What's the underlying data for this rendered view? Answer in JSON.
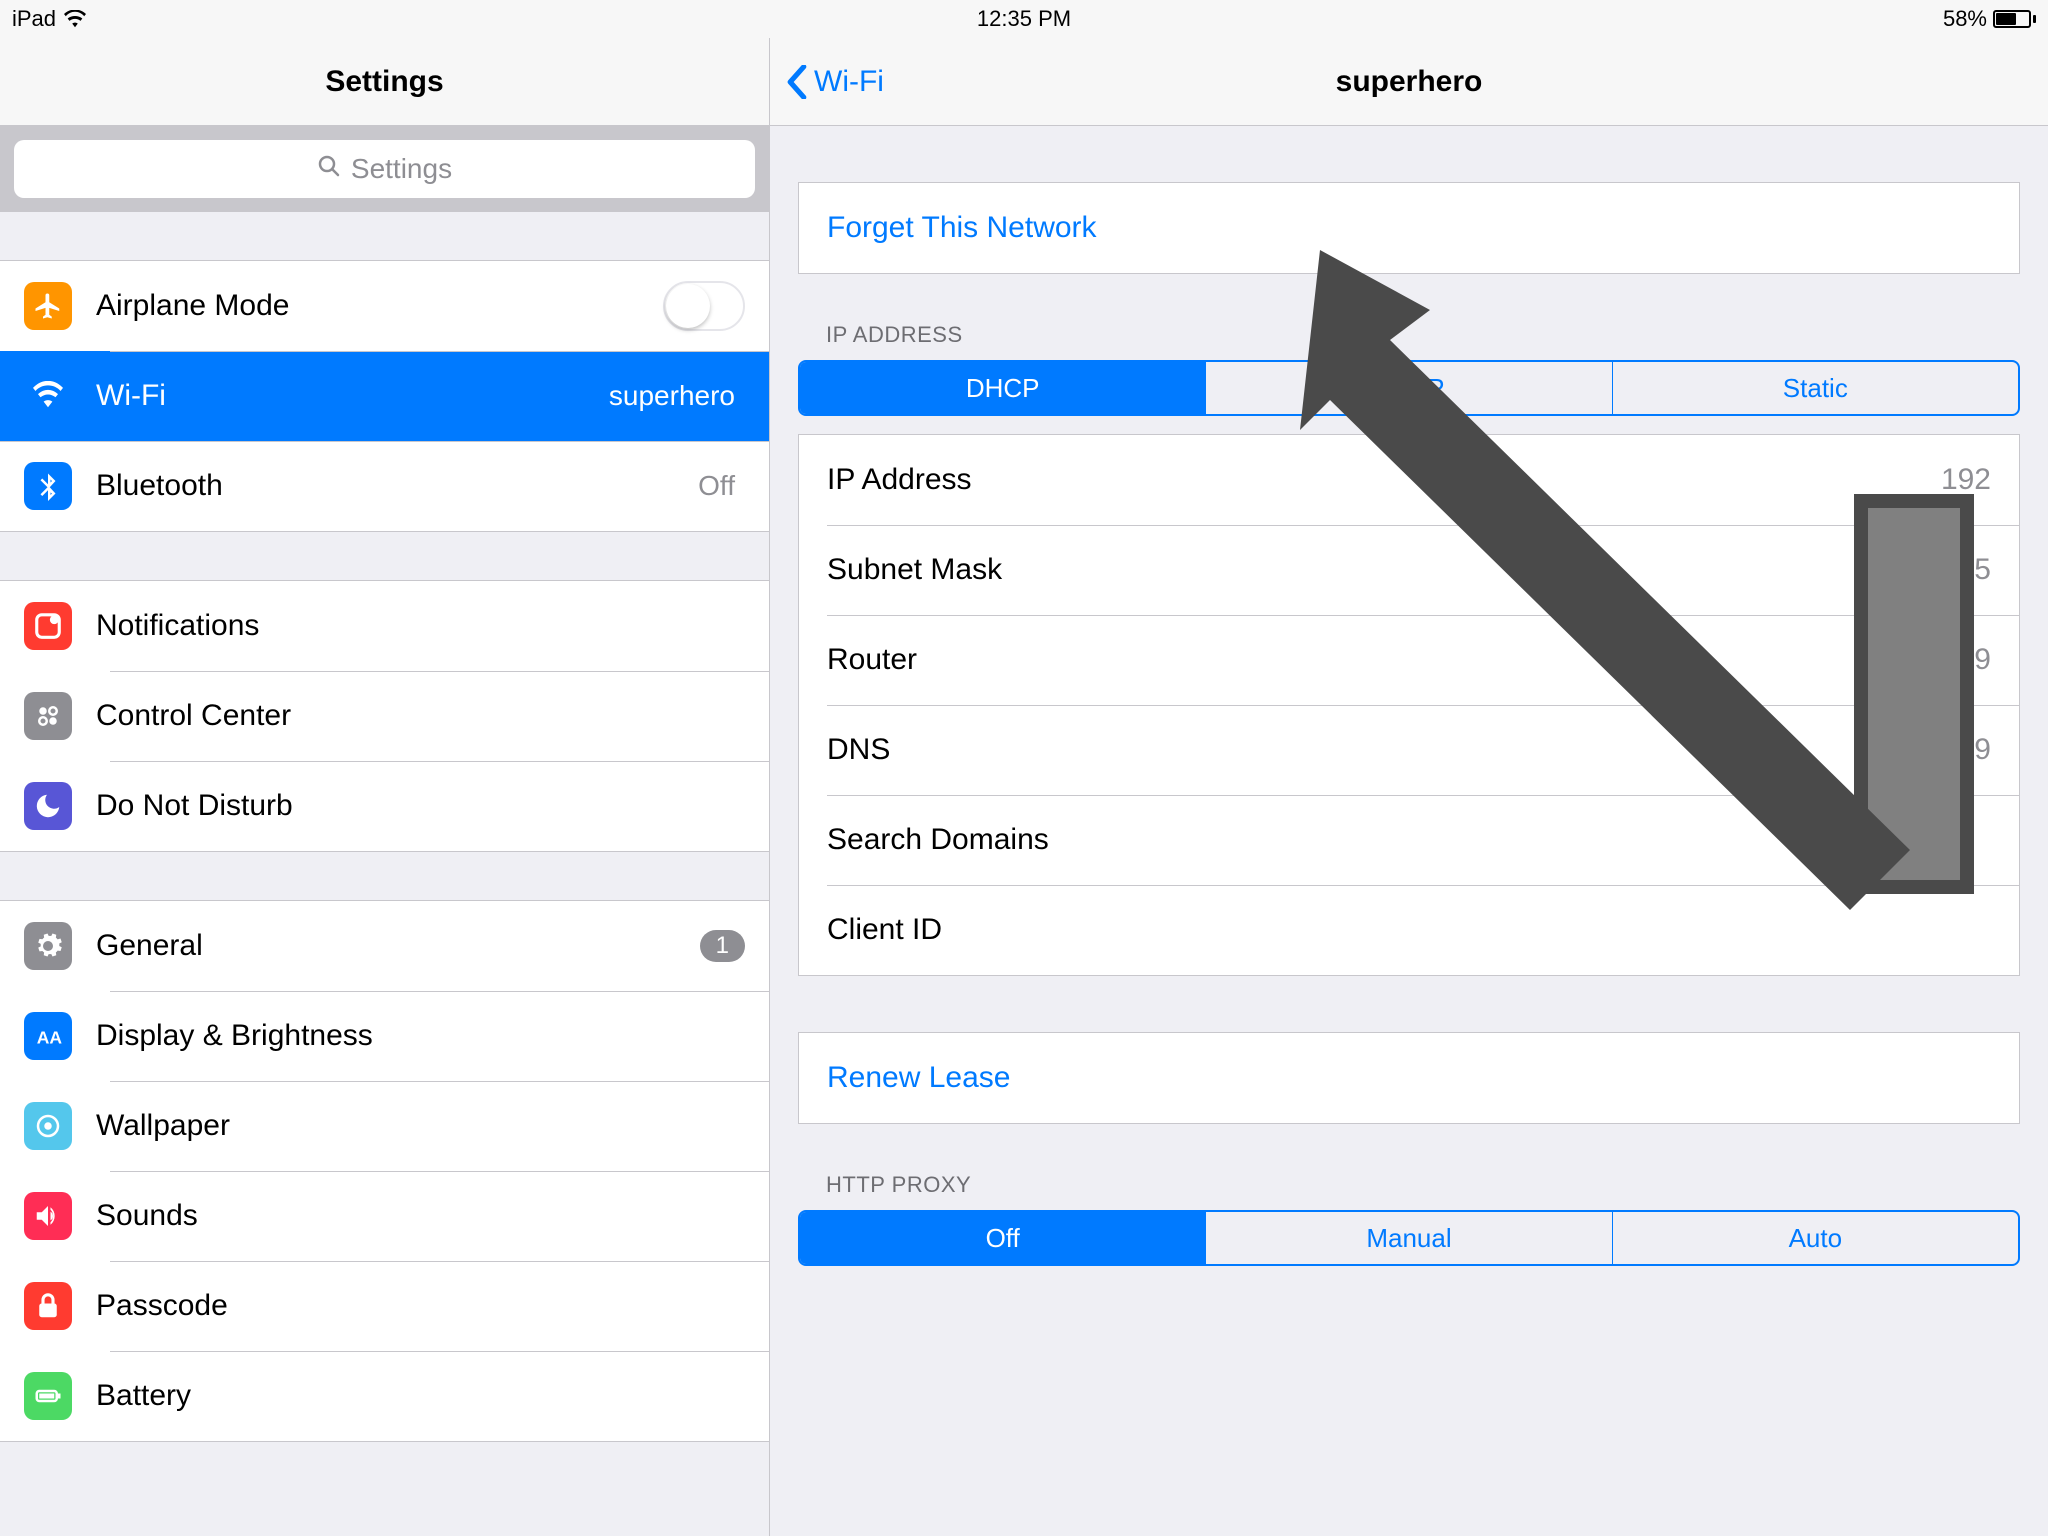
{
  "status": {
    "device": "iPad",
    "time": "12:35 PM",
    "battery_pct": "58%"
  },
  "left": {
    "title": "Settings",
    "search_placeholder": "Settings",
    "airplane": "Airplane Mode",
    "wifi": "Wi-Fi",
    "wifi_value": "superhero",
    "bluetooth": "Bluetooth",
    "bluetooth_value": "Off",
    "notifications": "Notifications",
    "control_center": "Control Center",
    "dnd": "Do Not Disturb",
    "general": "General",
    "general_badge": "1",
    "display": "Display & Brightness",
    "wallpaper": "Wallpaper",
    "sounds": "Sounds",
    "passcode": "Passcode",
    "battery": "Battery"
  },
  "right": {
    "back": "Wi-Fi",
    "title": "superhero",
    "forget": "Forget This Network",
    "ip_header": "IP ADDRESS",
    "seg_dhcp": "DHCP",
    "seg_bootp": "BootP",
    "seg_static": "Static",
    "rows": {
      "ip_label": "IP Address",
      "ip_value": "192",
      "subnet_label": "Subnet Mask",
      "subnet_value": "255.25",
      "router_label": "Router",
      "router_value": "19",
      "dns_label": "DNS",
      "dns_value": "19",
      "search_label": "Search Domains",
      "search_value": "",
      "client_label": "Client ID",
      "client_value": ""
    },
    "renew": "Renew Lease",
    "proxy_header": "HTTP PROXY",
    "seg_off": "Off",
    "seg_manual": "Manual",
    "seg_auto": "Auto"
  }
}
